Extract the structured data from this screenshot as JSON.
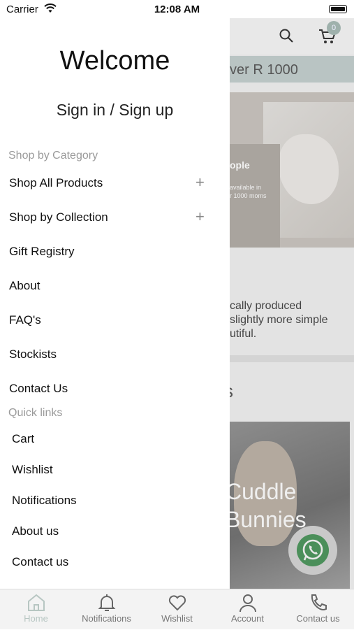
{
  "status_bar": {
    "carrier": "Carrier",
    "time": "12:08 AM"
  },
  "drawer": {
    "welcome": "Welcome",
    "sign_in": "Sign in / Sign up",
    "category_label": "Shop by Category",
    "menu_items": [
      {
        "label": "Shop All Products",
        "expandable": true
      },
      {
        "label": "Shop by Collection",
        "expandable": true
      },
      {
        "label": "Gift Registry",
        "expandable": false
      },
      {
        "label": "About",
        "expandable": false
      },
      {
        "label": "FAQ's",
        "expandable": false
      },
      {
        "label": "Stockists",
        "expandable": false
      },
      {
        "label": "Contact Us",
        "expandable": false
      }
    ],
    "quick_links_label": "Quick links",
    "quick_links": [
      "Cart",
      "Wishlist",
      "Notifications",
      "About us",
      "Contact us"
    ]
  },
  "background": {
    "cart_count": "0",
    "banner_text": "ver R 1000",
    "overlay_title": "ople",
    "overlay_sub_1": "available in",
    "overlay_sub_2": "r 1000 moms",
    "body_line_1": "cally produced",
    "body_line_2": "slightly more simple",
    "body_line_3": "utiful.",
    "heading_partial": "s",
    "product_line_1": "Cuddle",
    "product_line_2": "Bunnies"
  },
  "tab_bar": {
    "tabs": [
      {
        "label": "Home",
        "icon": "home-icon",
        "active": true
      },
      {
        "label": "Notifications",
        "icon": "bell-icon",
        "active": false
      },
      {
        "label": "Wishlist",
        "icon": "heart-icon",
        "active": false
      },
      {
        "label": "Account",
        "icon": "person-icon",
        "active": false
      },
      {
        "label": "Contact us",
        "icon": "phone-icon",
        "active": false
      }
    ]
  },
  "colors": {
    "accent": "#b7c6c2",
    "whatsapp": "#4b8f5a"
  }
}
